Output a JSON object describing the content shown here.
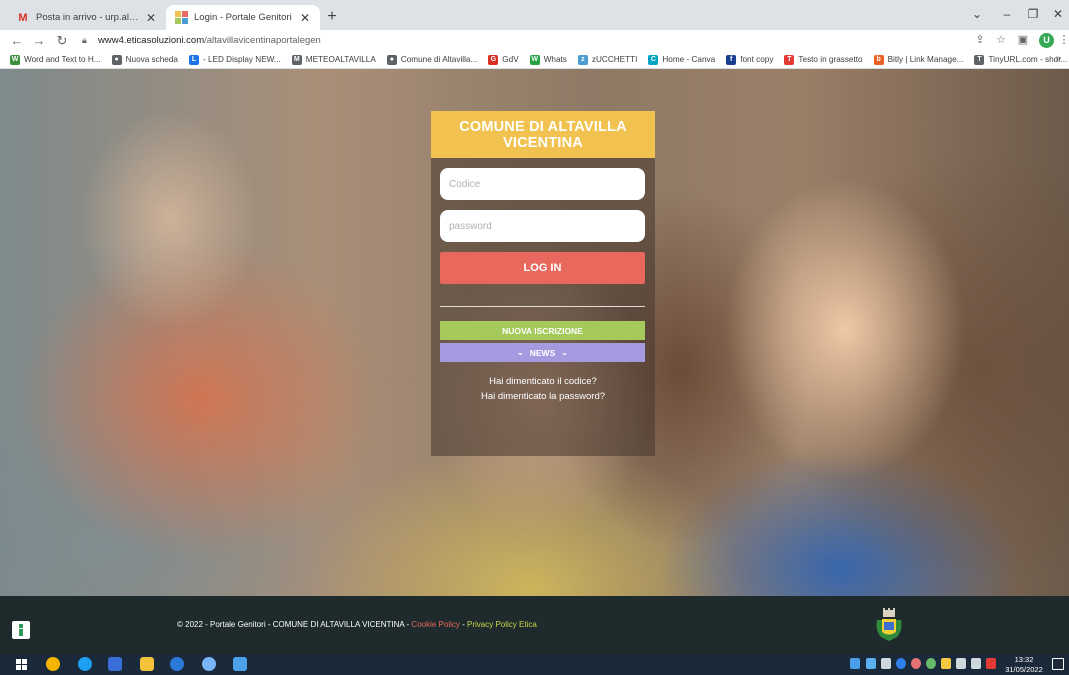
{
  "browser": {
    "tabs": [
      {
        "title": "Posta in arrivo - urp.altavillavicen",
        "icon": "gmail-icon",
        "active": false
      },
      {
        "title": "Login - Portale Genitori",
        "icon": "portal-favicon-icon",
        "active": true
      }
    ],
    "new_tab": "+",
    "url_host": "www4.eticasoluzioni.com",
    "url_path": "/altavillavicentinaportalegen",
    "profile_initial": "U"
  },
  "bookmarks": [
    {
      "label": "Word and Text to H...",
      "color": "#3b8e3b",
      "glyph": "W"
    },
    {
      "label": "Nuova scheda",
      "color": "#5f6368",
      "glyph": "●"
    },
    {
      "label": "- LED Display NEW...",
      "color": "#1a73e8",
      "glyph": "L"
    },
    {
      "label": "METEOALTAVILLA",
      "color": "#5f6368",
      "glyph": "M"
    },
    {
      "label": "Comune di Altavilla...",
      "color": "#5f6368",
      "glyph": "●"
    },
    {
      "label": "GdV",
      "color": "#d93025",
      "glyph": "G"
    },
    {
      "label": "Whats",
      "color": "#25a244",
      "glyph": "W"
    },
    {
      "label": "zUCCHETTI",
      "color": "#4b9cd3",
      "glyph": "z"
    },
    {
      "label": "Home - Canva",
      "color": "#00a3c4",
      "glyph": "C"
    },
    {
      "label": "font copy",
      "color": "#1a3f8f",
      "glyph": "f"
    },
    {
      "label": "Testo in grassetto",
      "color": "#e53935",
      "glyph": "T"
    },
    {
      "label": "Bitly | Link Manage...",
      "color": "#ee6123",
      "glyph": "b"
    },
    {
      "label": "TinyURL.com - shor...",
      "color": "#5f6368",
      "glyph": "T"
    }
  ],
  "login": {
    "header": "COMUNE DI ALTAVILLA VICENTINA",
    "codice_placeholder": "Codice",
    "password_placeholder": "password",
    "login_button": "LOG IN",
    "nuova_iscrizione": "NUOVA ISCRIZIONE",
    "news": "NEWS",
    "forgot_code": "Hai dimenticato il codice?",
    "forgot_password": "Hai dimenticato la password?"
  },
  "footer": {
    "copyright": "© 2022 - Portale Genitori - COMUNE DI ALTAVILLA VICENTINA - ",
    "cookie_policy": "Cookie Policy",
    "dash": " - ",
    "privacy_policy": "Privacy Policy Etica"
  },
  "taskbar": {
    "time": "13:32",
    "date": "31/05/2022"
  },
  "colors": {
    "header_yellow": "#f1c24f",
    "login_red": "#e8685e",
    "iscrizione_green": "#a5c95a",
    "news_purple": "#a59ae0",
    "footer_bg": "#1e2a2c"
  }
}
